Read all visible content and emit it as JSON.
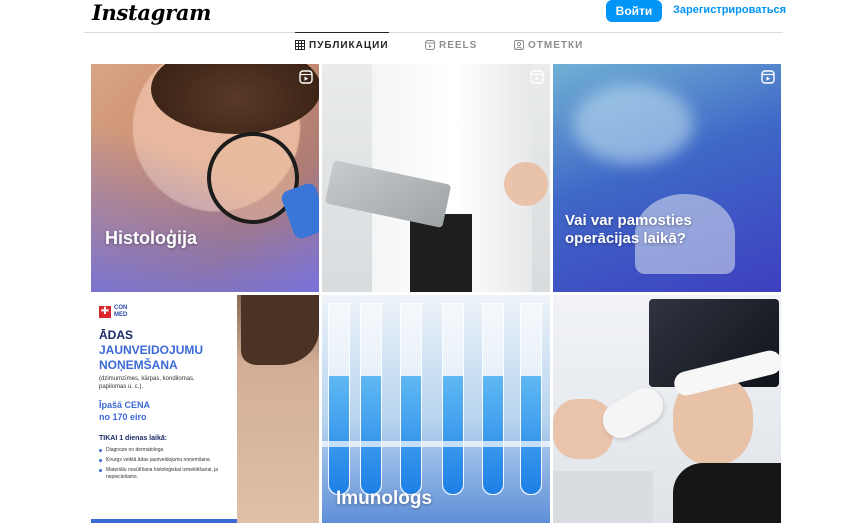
{
  "header": {
    "logo": "Instagram",
    "login_label": "Войти",
    "signup_label": "Зарегистрироваться"
  },
  "tabs": [
    {
      "label": "ПУБЛИКАЦИИ",
      "icon": "grid-icon",
      "active": true
    },
    {
      "label": "REELS",
      "icon": "reels-icon",
      "active": false
    },
    {
      "label": "ОТМЕТКИ",
      "icon": "tagged-icon",
      "active": false
    }
  ],
  "posts": [
    {
      "caption": "Histoloģija",
      "reel": true
    },
    {
      "caption": "",
      "reel": true
    },
    {
      "caption": "Vai var pamosties operācijas laikā?",
      "reel": true
    },
    {
      "caption": "",
      "reel": false,
      "flyer": {
        "brand": "CON MED",
        "title_line1": "ĀDAS",
        "title_line2": "JAUNVEIDOJUMU",
        "title_line3": "NOŅEMŠANA",
        "subtitle": "(dzimumzīmes, kārpas, kondilomas, papilomas u. c.).",
        "price_label": "Īpašā CENA",
        "price_value": "no 170 eiro",
        "only_label": "TIKAI 1 dienas laikā:",
        "items": [
          "Diagnoze no dermatologa",
          "Ķirurgs veiktā ādas jaunveidojumu noņemšana",
          "Materiālu nosūtīšana histoloģiskai izmeklēšanai, ja nepieciešams."
        ]
      }
    },
    {
      "caption": "Imunologs",
      "reel": false
    },
    {
      "caption": "",
      "reel": false
    }
  ],
  "colors": {
    "accent": "#0095f6",
    "divider": "#dbdbdb",
    "flyer_blue": "#3b69d6",
    "flyer_navy": "#1b2b66"
  }
}
